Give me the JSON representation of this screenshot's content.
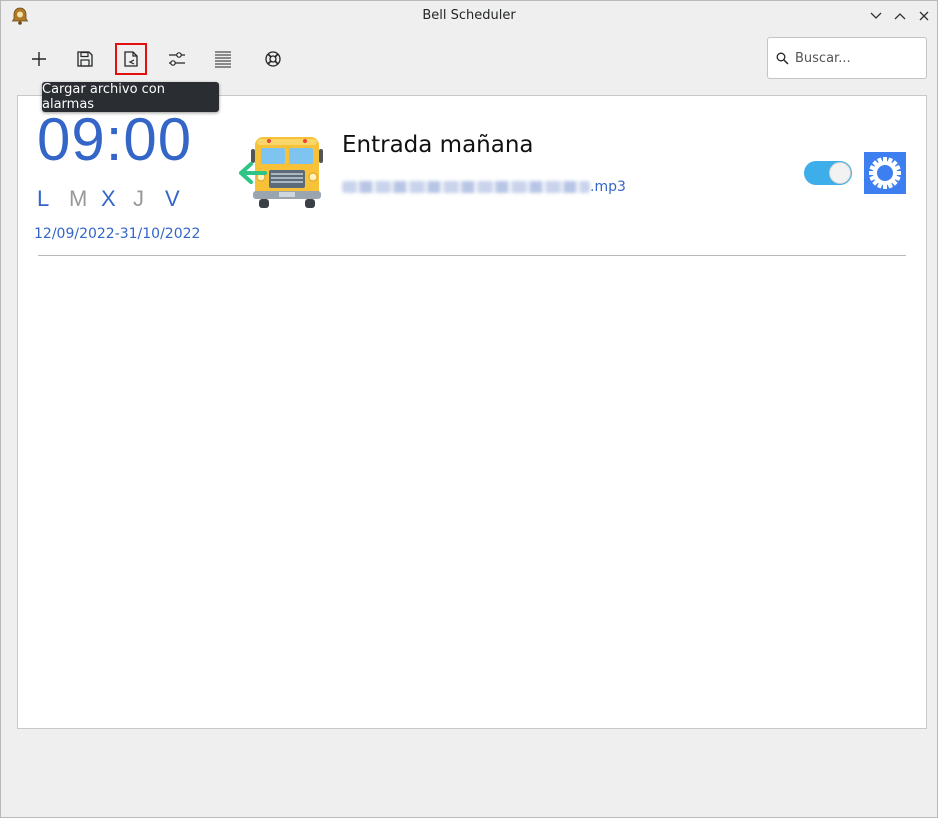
{
  "window": {
    "title": "Bell Scheduler"
  },
  "toolbar": {
    "buttons": [
      {
        "name": "add",
        "icon": "plus-icon"
      },
      {
        "name": "save",
        "icon": "floppy-icon"
      },
      {
        "name": "load",
        "icon": "import-file-icon",
        "active": true
      },
      {
        "name": "settings",
        "icon": "sliders-icon"
      },
      {
        "name": "list",
        "icon": "lines-icon"
      },
      {
        "name": "help",
        "icon": "lifebuoy-icon"
      }
    ],
    "tooltip": "Cargar archivo con alarmas"
  },
  "search": {
    "placeholder": "Buscar..."
  },
  "alarm": {
    "time": "09:00",
    "days": [
      {
        "label": "L",
        "active": true
      },
      {
        "label": "M",
        "active": false
      },
      {
        "label": "X",
        "active": true
      },
      {
        "label": "J",
        "active": false
      },
      {
        "label": "V",
        "active": true
      }
    ],
    "date_range": "12/09/2022-31/10/2022",
    "title": "Entrada mañana",
    "file_ext": ".mp3",
    "enabled": true
  },
  "colors": {
    "accent": "#3466c8",
    "day_inactive": "#999999",
    "toggle_on": "#3daee9",
    "gear_bg": "#3d7ff0",
    "highlight": "#e01010"
  }
}
